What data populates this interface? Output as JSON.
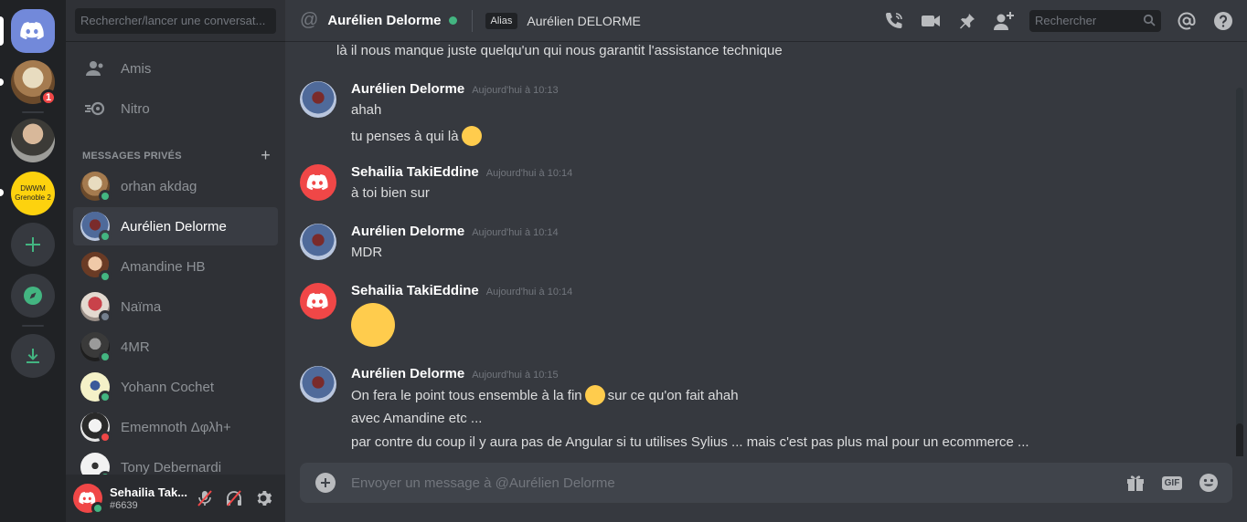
{
  "servers": {
    "home_icon": "discord-logo-icon",
    "badge_count": "1",
    "dwwm_line1": "DWWM",
    "dwwm_line2": "Grenoble 2"
  },
  "sidebar": {
    "search_placeholder": "Rechercher/lancer une conversat...",
    "nav": [
      {
        "label": "Amis",
        "icon": "friends-icon"
      },
      {
        "label": "Nitro",
        "icon": "nitro-icon"
      }
    ],
    "section_title": "MESSAGES PRIVÉS",
    "dms": [
      {
        "name": "orhan akdag",
        "status": "online"
      },
      {
        "name": "Aurélien Delorme",
        "status": "online"
      },
      {
        "name": "Amandine HB",
        "status": "online"
      },
      {
        "name": "Naïma",
        "status": "idle"
      },
      {
        "name": "4MR",
        "status": "online"
      },
      {
        "name": "Yohann Cochet",
        "status": "online"
      },
      {
        "name": "Ememnoth Δφλh+",
        "status": "dnd"
      },
      {
        "name": "Tony Debernardi",
        "status": "online"
      }
    ],
    "user": {
      "name": "Sehailia Tak...",
      "tag": "#6639"
    }
  },
  "header": {
    "channel_name": "Aurélien Delorme",
    "alias_label": "Alias",
    "alias_value": "Aurélien DELORME",
    "search_placeholder": "Rechercher"
  },
  "messages": {
    "top_line": "là il nous manque juste quelqu'un qui nous garantit l'assistance technique",
    "groups": [
      {
        "author": "Aurélien Delorme",
        "time": "Aujourd'hui à 10:13",
        "lines": [
          "ahah",
          "tu penses à qui là"
        ]
      },
      {
        "author": "Sehailia TakiEddine",
        "time": "Aujourd'hui à 10:14",
        "lines": [
          "à toi bien sur"
        ]
      },
      {
        "author": "Aurélien Delorme",
        "time": "Aujourd'hui à 10:14",
        "lines": [
          "MDR"
        ]
      },
      {
        "author": "Sehailia TakiEddine",
        "time": "Aujourd'hui à 10:14",
        "lines": []
      },
      {
        "author": "Aurélien Delorme",
        "time": "Aujourd'hui à 10:15",
        "lines": [
          "On fera le point tous ensemble à la fin",
          "sur ce qu'on fait ahah",
          "avec Amandine etc ...",
          "par contre du coup il y aura pas de Angular si tu utilises Sylius ... mais c'est pas plus mal pour un ecommerce ..."
        ]
      }
    ]
  },
  "composer": {
    "placeholder": "Envoyer un message à @Aurélien Delorme",
    "gif_label": "GIF"
  },
  "colors": {
    "blurple": "#7289da",
    "online": "#43b581",
    "dnd": "#f04747",
    "idle": "#747f8d",
    "dwwm": "#fdd20e"
  }
}
